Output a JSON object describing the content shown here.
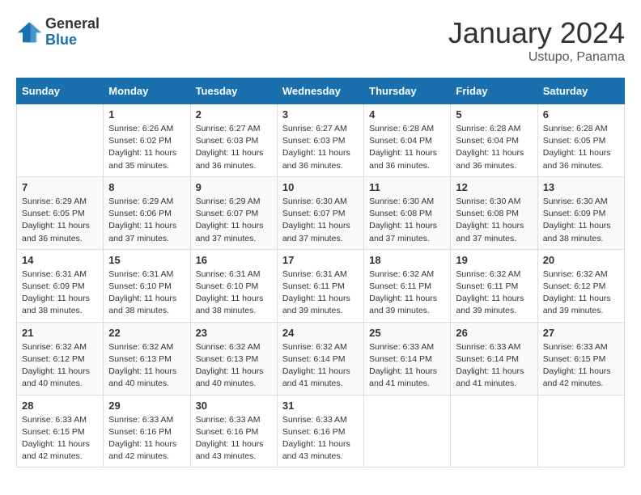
{
  "header": {
    "logo_general": "General",
    "logo_blue": "Blue",
    "month_year": "January 2024",
    "location": "Ustupo, Panama"
  },
  "columns": [
    "Sunday",
    "Monday",
    "Tuesday",
    "Wednesday",
    "Thursday",
    "Friday",
    "Saturday"
  ],
  "weeks": [
    [
      {
        "day": "",
        "info": ""
      },
      {
        "day": "1",
        "info": "Sunrise: 6:26 AM\nSunset: 6:02 PM\nDaylight: 11 hours\nand 35 minutes."
      },
      {
        "day": "2",
        "info": "Sunrise: 6:27 AM\nSunset: 6:03 PM\nDaylight: 11 hours\nand 36 minutes."
      },
      {
        "day": "3",
        "info": "Sunrise: 6:27 AM\nSunset: 6:03 PM\nDaylight: 11 hours\nand 36 minutes."
      },
      {
        "day": "4",
        "info": "Sunrise: 6:28 AM\nSunset: 6:04 PM\nDaylight: 11 hours\nand 36 minutes."
      },
      {
        "day": "5",
        "info": "Sunrise: 6:28 AM\nSunset: 6:04 PM\nDaylight: 11 hours\nand 36 minutes."
      },
      {
        "day": "6",
        "info": "Sunrise: 6:28 AM\nSunset: 6:05 PM\nDaylight: 11 hours\nand 36 minutes."
      }
    ],
    [
      {
        "day": "7",
        "info": "Sunrise: 6:29 AM\nSunset: 6:05 PM\nDaylight: 11 hours\nand 36 minutes."
      },
      {
        "day": "8",
        "info": "Sunrise: 6:29 AM\nSunset: 6:06 PM\nDaylight: 11 hours\nand 37 minutes."
      },
      {
        "day": "9",
        "info": "Sunrise: 6:29 AM\nSunset: 6:07 PM\nDaylight: 11 hours\nand 37 minutes."
      },
      {
        "day": "10",
        "info": "Sunrise: 6:30 AM\nSunset: 6:07 PM\nDaylight: 11 hours\nand 37 minutes."
      },
      {
        "day": "11",
        "info": "Sunrise: 6:30 AM\nSunset: 6:08 PM\nDaylight: 11 hours\nand 37 minutes."
      },
      {
        "day": "12",
        "info": "Sunrise: 6:30 AM\nSunset: 6:08 PM\nDaylight: 11 hours\nand 37 minutes."
      },
      {
        "day": "13",
        "info": "Sunrise: 6:30 AM\nSunset: 6:09 PM\nDaylight: 11 hours\nand 38 minutes."
      }
    ],
    [
      {
        "day": "14",
        "info": "Sunrise: 6:31 AM\nSunset: 6:09 PM\nDaylight: 11 hours\nand 38 minutes."
      },
      {
        "day": "15",
        "info": "Sunrise: 6:31 AM\nSunset: 6:10 PM\nDaylight: 11 hours\nand 38 minutes."
      },
      {
        "day": "16",
        "info": "Sunrise: 6:31 AM\nSunset: 6:10 PM\nDaylight: 11 hours\nand 38 minutes."
      },
      {
        "day": "17",
        "info": "Sunrise: 6:31 AM\nSunset: 6:11 PM\nDaylight: 11 hours\nand 39 minutes."
      },
      {
        "day": "18",
        "info": "Sunrise: 6:32 AM\nSunset: 6:11 PM\nDaylight: 11 hours\nand 39 minutes."
      },
      {
        "day": "19",
        "info": "Sunrise: 6:32 AM\nSunset: 6:11 PM\nDaylight: 11 hours\nand 39 minutes."
      },
      {
        "day": "20",
        "info": "Sunrise: 6:32 AM\nSunset: 6:12 PM\nDaylight: 11 hours\nand 39 minutes."
      }
    ],
    [
      {
        "day": "21",
        "info": "Sunrise: 6:32 AM\nSunset: 6:12 PM\nDaylight: 11 hours\nand 40 minutes."
      },
      {
        "day": "22",
        "info": "Sunrise: 6:32 AM\nSunset: 6:13 PM\nDaylight: 11 hours\nand 40 minutes."
      },
      {
        "day": "23",
        "info": "Sunrise: 6:32 AM\nSunset: 6:13 PM\nDaylight: 11 hours\nand 40 minutes."
      },
      {
        "day": "24",
        "info": "Sunrise: 6:32 AM\nSunset: 6:14 PM\nDaylight: 11 hours\nand 41 minutes."
      },
      {
        "day": "25",
        "info": "Sunrise: 6:33 AM\nSunset: 6:14 PM\nDaylight: 11 hours\nand 41 minutes."
      },
      {
        "day": "26",
        "info": "Sunrise: 6:33 AM\nSunset: 6:14 PM\nDaylight: 11 hours\nand 41 minutes."
      },
      {
        "day": "27",
        "info": "Sunrise: 6:33 AM\nSunset: 6:15 PM\nDaylight: 11 hours\nand 42 minutes."
      }
    ],
    [
      {
        "day": "28",
        "info": "Sunrise: 6:33 AM\nSunset: 6:15 PM\nDaylight: 11 hours\nand 42 minutes."
      },
      {
        "day": "29",
        "info": "Sunrise: 6:33 AM\nSunset: 6:16 PM\nDaylight: 11 hours\nand 42 minutes."
      },
      {
        "day": "30",
        "info": "Sunrise: 6:33 AM\nSunset: 6:16 PM\nDaylight: 11 hours\nand 43 minutes."
      },
      {
        "day": "31",
        "info": "Sunrise: 6:33 AM\nSunset: 6:16 PM\nDaylight: 11 hours\nand 43 minutes."
      },
      {
        "day": "",
        "info": ""
      },
      {
        "day": "",
        "info": ""
      },
      {
        "day": "",
        "info": ""
      }
    ]
  ]
}
